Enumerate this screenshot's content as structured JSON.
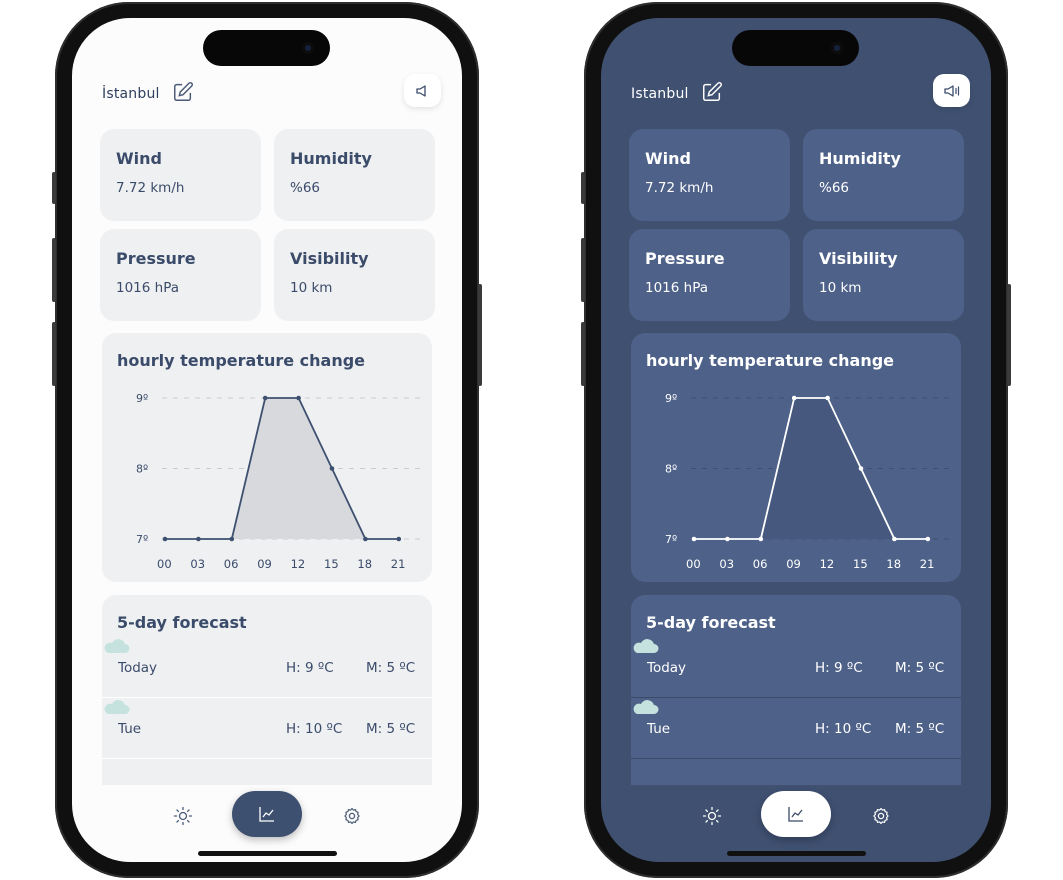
{
  "city": "İstanbul",
  "city_dark": "Istanbul",
  "cards": [
    {
      "title": "Wind",
      "value": "7.72 km/h"
    },
    {
      "title": "Humidity",
      "value": "%66"
    },
    {
      "title": "Pressure",
      "value": "1016 hPa"
    },
    {
      "title": "Visibility",
      "value": "10 km"
    }
  ],
  "chart_data": {
    "type": "area",
    "title": "hourly temperature change",
    "x": [
      "00",
      "03",
      "06",
      "09",
      "12",
      "15",
      "18",
      "21"
    ],
    "values": [
      7,
      7,
      7,
      9,
      9,
      8,
      7,
      7
    ],
    "y_ticks": [
      "7º",
      "8º",
      "9º"
    ],
    "ylim": [
      7,
      9
    ],
    "grid": true
  },
  "forecast": {
    "title": "5-day forecast",
    "rows": [
      {
        "day": "Today",
        "high": "H: 9 ºC",
        "low": "M: 5 ºC",
        "icon": "cloud-icon"
      },
      {
        "day": "Tue",
        "high": "H: 10 ºC",
        "low": "M: 5 ºC",
        "icon": "cloud-icon"
      }
    ]
  },
  "nav": {
    "items": [
      "sun-icon",
      "chart-icon",
      "gear-icon"
    ],
    "active": "chart-icon"
  },
  "colors": {
    "light_bg": "#fcfcfc",
    "dark_bg": "#3f5071",
    "card_light": "#eff0f2",
    "card_dark": "#4e6189",
    "accent": "#3e5070",
    "cloud": "#c5e2df"
  }
}
